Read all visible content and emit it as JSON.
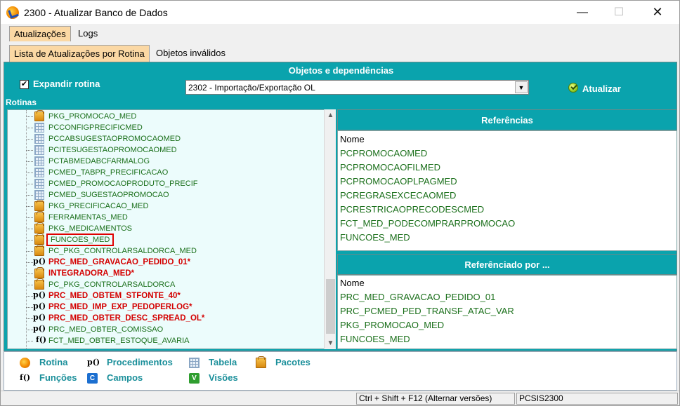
{
  "window": {
    "title": "2300 - Atualizar Banco de Dados",
    "minimize": "—",
    "maximize": "☐",
    "close": "✕"
  },
  "tabs": {
    "primary": [
      {
        "label": "Atualizações",
        "active": true
      },
      {
        "label": "Logs",
        "active": false
      }
    ],
    "secondary": [
      {
        "label": "Lista de Atualizações por Rotina",
        "active": true
      },
      {
        "label": "Objetos inválidos",
        "active": false
      }
    ]
  },
  "panel": {
    "title": "Objetos e dependências",
    "expand_label": "Expandir rotina",
    "expand_checked": true,
    "check_mark": "✔",
    "routine_select": "2302 - Importação/Exportação OL",
    "select_arrow": "▼",
    "update_label": "Atualizar",
    "rotinas_label": "Rotinas"
  },
  "tree": {
    "items": [
      {
        "icon": "pkg",
        "text": "PKG_PROMOCAO_MED",
        "style": "normal"
      },
      {
        "icon": "table",
        "text": "PCCONFIGPRECIFICMED",
        "style": "normal"
      },
      {
        "icon": "table",
        "text": "PCCABSUGESTAOPROMOCAOMED",
        "style": "normal"
      },
      {
        "icon": "table",
        "text": "PCITESUGESTAOPROMOCAOMED",
        "style": "normal"
      },
      {
        "icon": "table",
        "text": "PCTABMEDABCFARMALOG",
        "style": "normal"
      },
      {
        "icon": "table",
        "text": "PCMED_TABPR_PRECIFICACAO",
        "style": "normal"
      },
      {
        "icon": "table",
        "text": "PCMED_PROMOCAOPRODUTO_PRECIF",
        "style": "normal"
      },
      {
        "icon": "table",
        "text": "PCMED_SUGESTAOPROMOCAO",
        "style": "normal"
      },
      {
        "icon": "pkg",
        "text": "PKG_PRECIFICACAO_MED",
        "style": "normal"
      },
      {
        "icon": "pkg",
        "text": "FERRAMENTAS_MED",
        "style": "normal"
      },
      {
        "icon": "pkg",
        "text": "PKG_MEDICAMENTOS",
        "style": "normal"
      },
      {
        "icon": "pkg",
        "text": "FUNCOES_MED",
        "style": "highlight"
      },
      {
        "icon": "pkg",
        "text": "PC_PKG_CONTROLARSALDORCA_MED",
        "style": "normal"
      },
      {
        "icon": "proc",
        "text": "PRC_MED_GRAVACAO_PEDIDO_01*",
        "style": "red"
      },
      {
        "icon": "pkg",
        "text": "INTEGRADORA_MED*",
        "style": "red"
      },
      {
        "icon": "pkg",
        "text": "PC_PKG_CONTROLARSALDORCA",
        "style": "normal"
      },
      {
        "icon": "proc",
        "text": "PRC_MED_OBTEM_STFONTE_40*",
        "style": "red"
      },
      {
        "icon": "proc",
        "text": "PRC_MED_IMP_EXP_PEDOPERLOG*",
        "style": "red"
      },
      {
        "icon": "proc",
        "text": "PRC_MED_OBTER_DESC_SPREAD_OL*",
        "style": "red"
      },
      {
        "icon": "proc",
        "text": "PRC_MED_OBTER_COMISSAO",
        "style": "normal"
      },
      {
        "icon": "func",
        "text": "FCT_MED_OBTER_ESTOQUE_AVARIA",
        "style": "normal"
      }
    ],
    "proc_glyph": "p()",
    "func_glyph": "f()",
    "scroll_up": "▲",
    "scroll_down": "▼"
  },
  "references": {
    "title": "Referências",
    "column": "Nome",
    "items": [
      "PCPROMOCAOMED",
      "PCPROMOCAOFILMED",
      "PCPROMOCAOPLPAGMED",
      "PCREGRASEXCECAOMED",
      "PCRESTRICAOPRECODESCMED",
      "FCT_MED_PODECOMPRARPROMOCAO",
      "FUNCOES_MED"
    ]
  },
  "referenced_by": {
    "title": "Referênciado por ...",
    "column": "Nome",
    "items": [
      "PRC_MED_GRAVACAO_PEDIDO_01",
      "PRC_PCMED_PED_TRANSF_ATAC_VAR",
      "PKG_PROMOCAO_MED",
      "FUNCOES_MED"
    ]
  },
  "legend": {
    "rotina": "Rotina",
    "procedimentos": "Procedimentos",
    "tabela": "Tabela",
    "pacotes": "Pacotes",
    "funcoes": "Funções",
    "campos": "Campos",
    "visoes": "Visões",
    "proc_glyph": "p()",
    "func_glyph": "f()",
    "campos_glyph": "C",
    "visoes_glyph": "V"
  },
  "status": {
    "shortcut": "Ctrl + Shift + F12 (Alternar versões)",
    "code": "PCSIS2300"
  }
}
